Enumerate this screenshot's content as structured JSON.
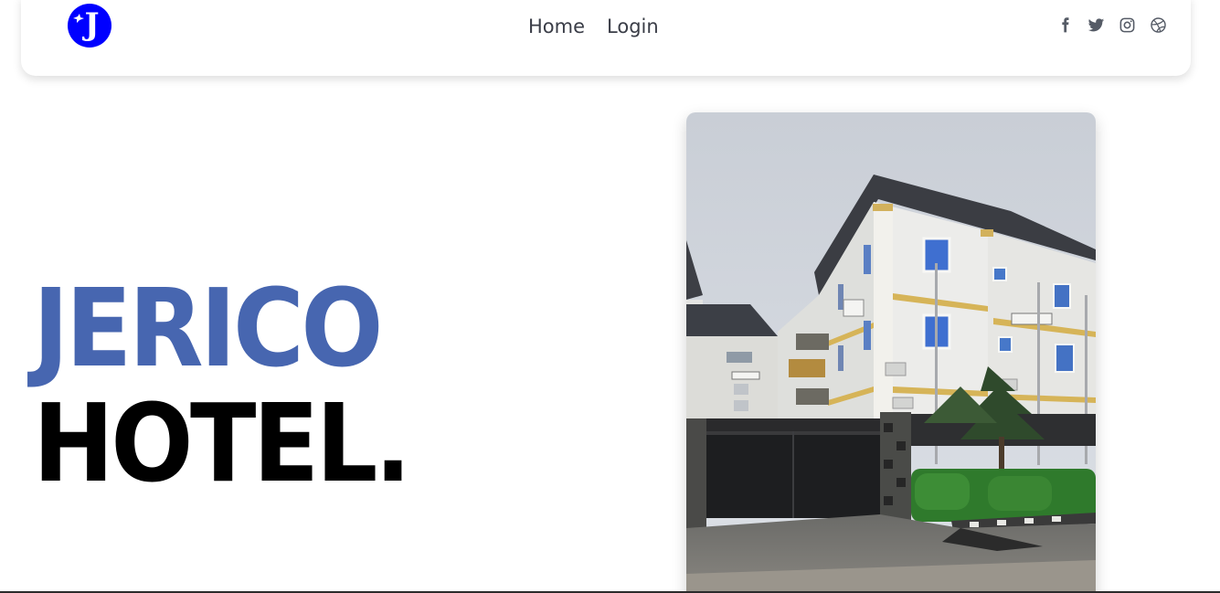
{
  "nav": {
    "logo": {
      "letter": "J",
      "color": "#0000ff"
    },
    "links": [
      {
        "label": "Home"
      },
      {
        "label": "Login"
      }
    ],
    "socials": [
      {
        "icon": "facebook-icon"
      },
      {
        "icon": "twitter-icon"
      },
      {
        "icon": "instagram-icon"
      },
      {
        "icon": "dribbble-icon"
      }
    ]
  },
  "hero": {
    "title_line_1": "JERICO",
    "title_line_2": "HOTEL.",
    "accent_color": "#4766b0",
    "image": {
      "subject": "hotel-building-photo"
    }
  }
}
